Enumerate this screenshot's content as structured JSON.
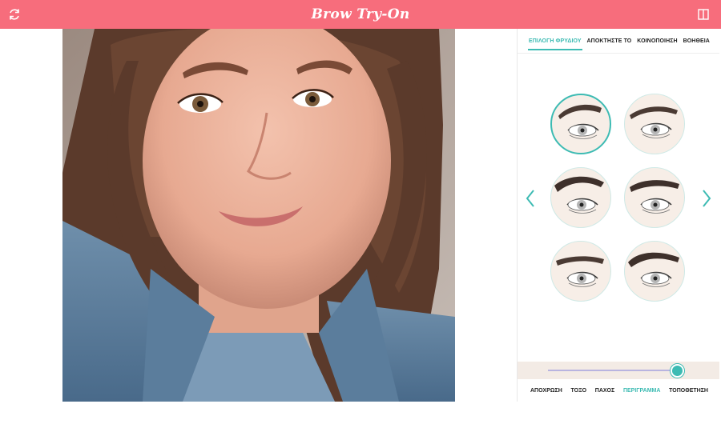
{
  "header": {
    "title": "Brow Try-On",
    "refresh_icon": "refresh-icon",
    "panel_icon": "split-panel-icon",
    "background": "#f76d7c"
  },
  "tabs": [
    {
      "label": "ΕΠΙΛΟΓΗ ΦΡΥΔΙΟΥ",
      "active": true
    },
    {
      "label": "ΑΠΟΚΤΗΣΤΕ ΤΟ",
      "active": false
    },
    {
      "label": "ΚΟΙΝΟΠΟΙΗΣΗ",
      "active": false
    },
    {
      "label": "ΒΟΗΘΕΙΑ",
      "active": false
    }
  ],
  "brow_styles": {
    "selected_index": 0,
    "items": [
      "brow-style-1",
      "brow-style-2",
      "brow-style-3",
      "brow-style-4",
      "brow-style-5",
      "brow-style-6"
    ]
  },
  "navigation": {
    "prev_icon": "chevron-left-icon",
    "next_icon": "chevron-right-icon"
  },
  "slider": {
    "value_fraction": 0.96
  },
  "bottom_tabs": [
    {
      "label": "ΑΠΟΧΡΩΣΗ",
      "active": false
    },
    {
      "label": "ΤΟΞΟ",
      "active": false
    },
    {
      "label": "ΠΑΧΟΣ",
      "active": false
    },
    {
      "label": "ΠΕΡΙΓΡΑΜΜΑ",
      "active": true
    },
    {
      "label": "ΤΟΠΟΘΕΤΗΣΗ",
      "active": false
    }
  ],
  "accent_color": "#3dbbb3"
}
